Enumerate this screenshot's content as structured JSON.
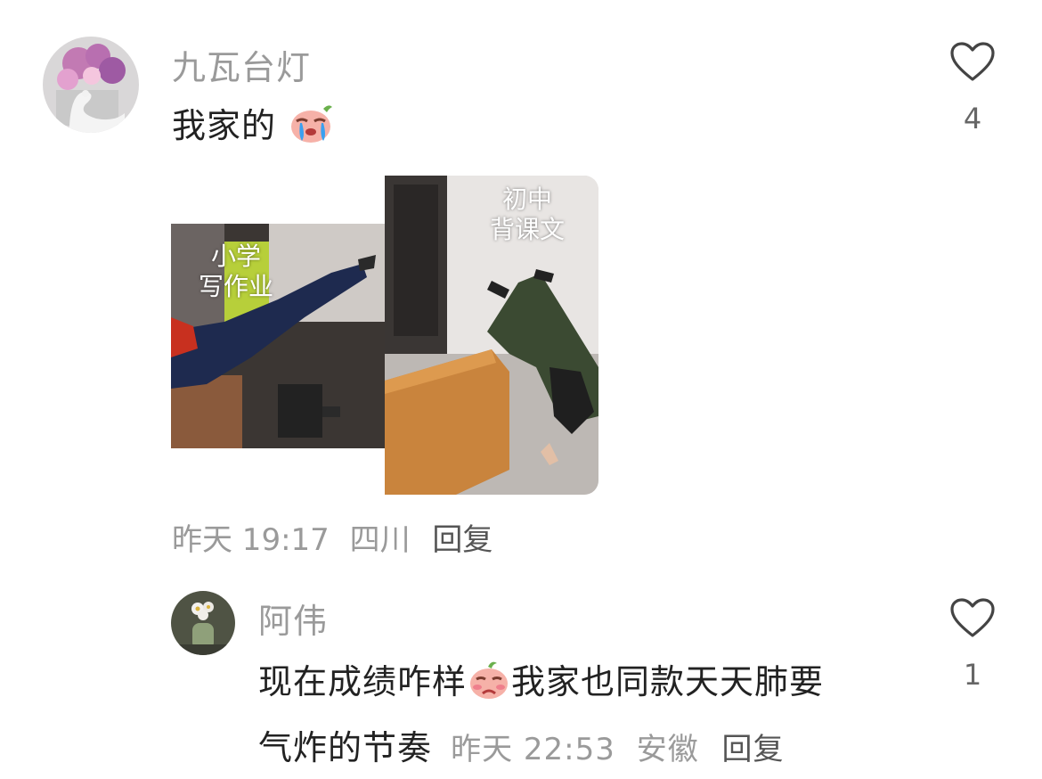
{
  "comments": [
    {
      "username": "九瓦台灯",
      "text": "我家的",
      "like_count": "4",
      "images": [
        {
          "caption_lines": [
            "小学",
            "写作业"
          ]
        },
        {
          "caption_lines": [
            "初中",
            "背课文"
          ]
        }
      ],
      "meta": {
        "time": "昨天 19:17",
        "location": "四川",
        "reply": "回复"
      }
    },
    {
      "username": "阿伟",
      "text_line1_a": "现在成绩咋样",
      "text_line1_b": "我家也同款天天肺要",
      "text_line2": "气炸的节奏",
      "like_count": "1",
      "meta": {
        "time": "昨天 22:53",
        "location": "安徽",
        "reply": "回复"
      }
    }
  ],
  "colors": {
    "username": "#9a9a9a",
    "content": "#222222",
    "meta": "#9a9a9a"
  },
  "icons": [
    "heart-outline-icon",
    "emoji-crying-icon",
    "emoji-shy-icon"
  ]
}
